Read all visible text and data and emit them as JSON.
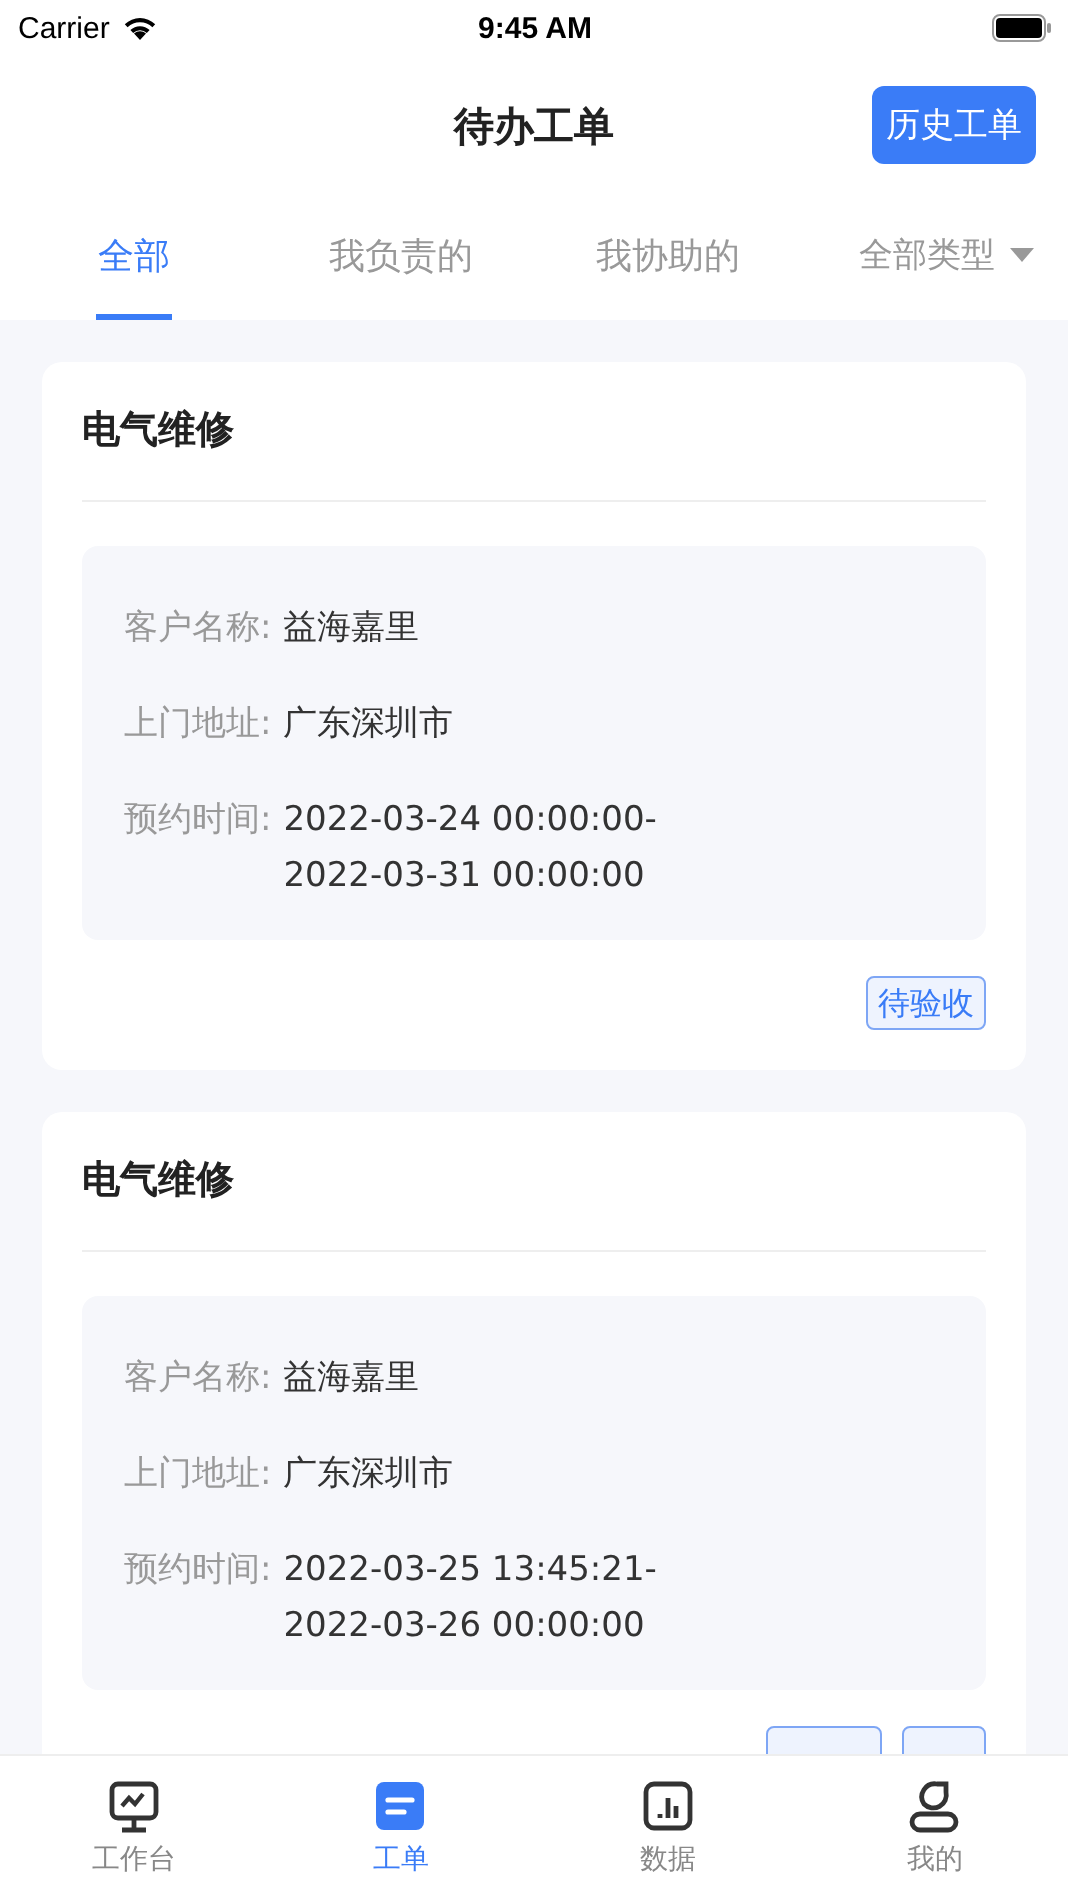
{
  "status_bar": {
    "carrier": "Carrier",
    "time": "9:45 AM"
  },
  "header": {
    "title": "待办工单",
    "action": "历史工单"
  },
  "tabs": [
    {
      "label": "全部",
      "selected": true
    },
    {
      "label": "我负责的",
      "selected": false
    },
    {
      "label": "我协助的",
      "selected": false
    }
  ],
  "type_filter": {
    "label": "全部类型"
  },
  "orders": [
    {
      "title": "电气维修",
      "fields": [
        {
          "label": "客户名称:",
          "value": "益海嘉里"
        },
        {
          "label": "上门地址:",
          "value": "广东深圳市"
        },
        {
          "label": "预约时间:",
          "value": "2022-03-24 00:00:00-\n2022-03-31 00:00:00"
        }
      ],
      "tags": [
        {
          "kind": "text",
          "text": "待验收"
        }
      ]
    },
    {
      "title": "电气维修",
      "fields": [
        {
          "label": "客户名称:",
          "value": "益海嘉里"
        },
        {
          "label": "上门地址:",
          "value": "广东深圳市"
        },
        {
          "label": "预约时间:",
          "value": "2022-03-25 13:45:21-\n2022-03-26 00:00:00"
        }
      ],
      "tags": [
        {
          "kind": "cut"
        },
        {
          "kind": "cut"
        }
      ]
    }
  ],
  "tab_bar": [
    {
      "label": "工作台",
      "kind": "monitor",
      "selected": false
    },
    {
      "label": "工单",
      "kind": "order",
      "selected": true
    },
    {
      "label": "数据",
      "kind": "chart",
      "selected": false
    },
    {
      "label": "我的",
      "kind": "person",
      "selected": false
    }
  ]
}
